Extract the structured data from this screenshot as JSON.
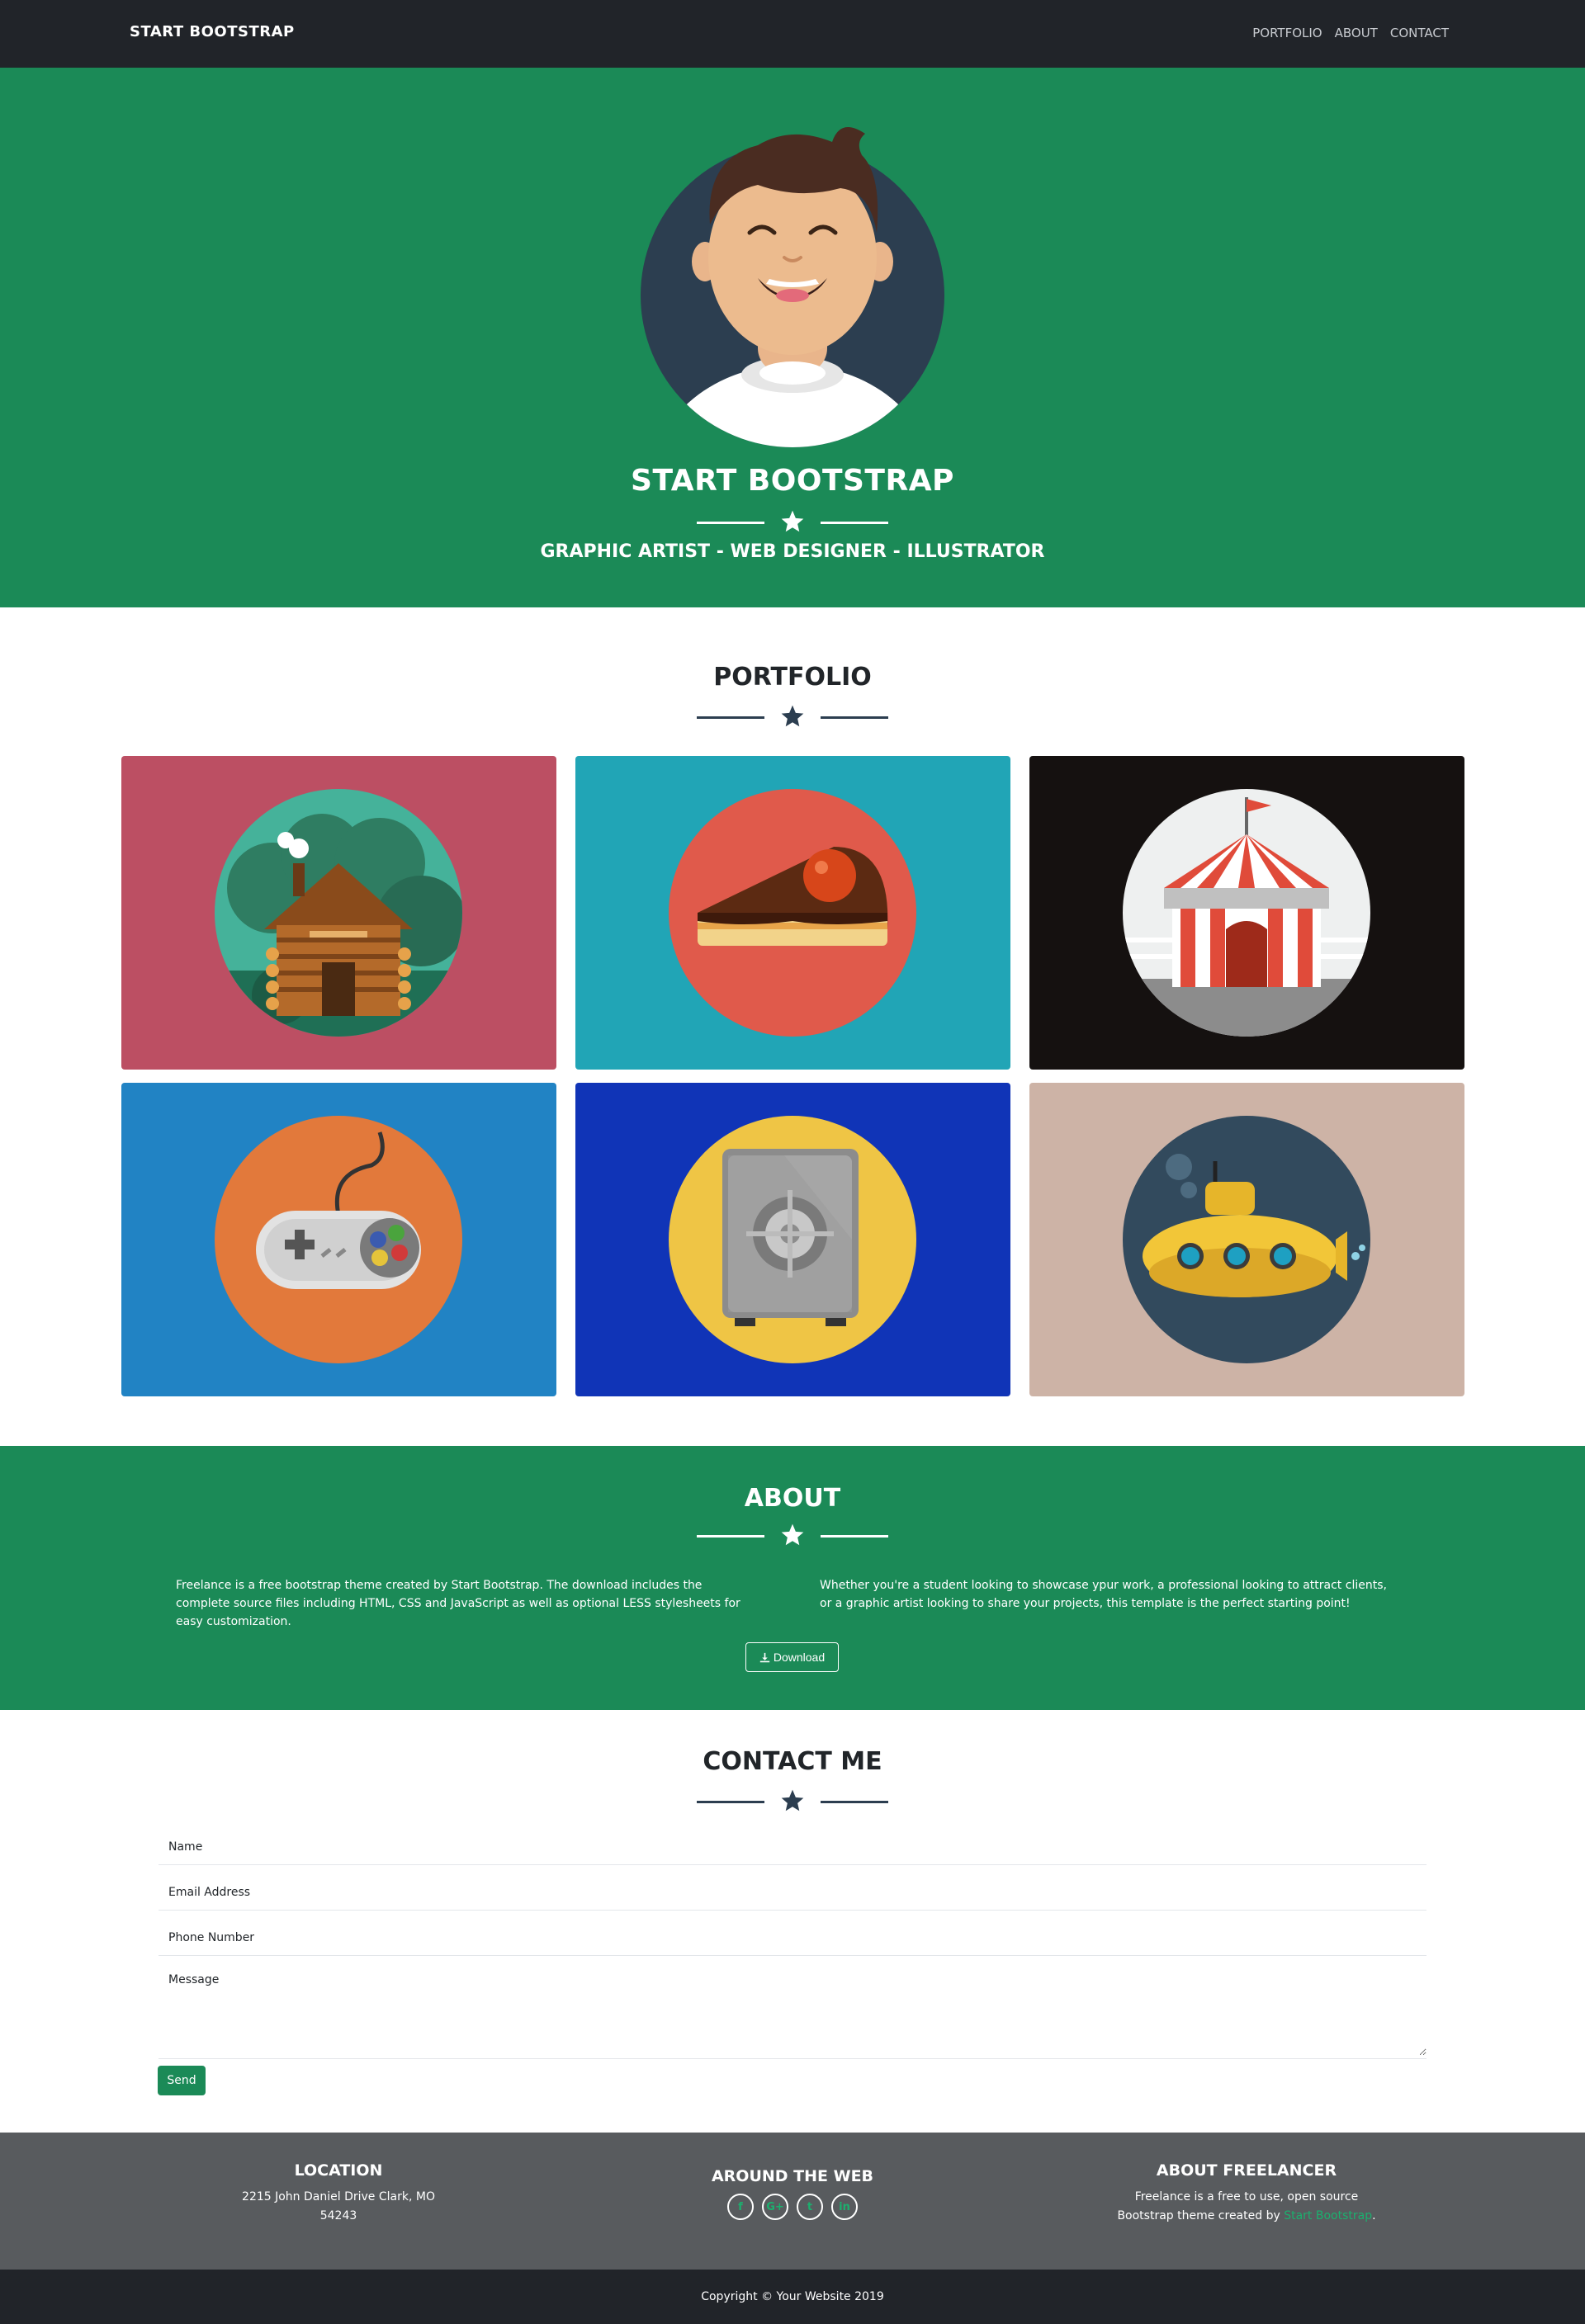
{
  "navbar": {
    "brand": "START BOOTSTRAP",
    "links": [
      "PORTFOLIO",
      "ABOUT",
      "CONTACT"
    ]
  },
  "hero": {
    "title": "START BOOTSTRAP",
    "subtitle": "GRAPHIC ARTIST - WEB DESIGNER - ILLUSTRATOR"
  },
  "portfolio": {
    "heading": "PORTFOLIO",
    "items": [
      {
        "icon": "cabin-icon",
        "bg": "#bc4f63"
      },
      {
        "icon": "cake-icon",
        "bg": "#21a5b6"
      },
      {
        "icon": "circus-tent-icon",
        "bg": "#151110"
      },
      {
        "icon": "game-controller-icon",
        "bg": "#2183c4"
      },
      {
        "icon": "safe-icon",
        "bg": "#1034b7"
      },
      {
        "icon": "submarine-icon",
        "bg": "#cdb3a6"
      }
    ]
  },
  "about": {
    "heading": "ABOUT",
    "left_text": "Freelance is a free bootstrap theme created by Start Bootstrap. The download includes the complete source files including HTML, CSS and JavaScript as well as optional LESS stylesheets for easy customization.",
    "right_text": "Whether you're a student looking to showcase ypur work, a professional looking to attract clients, or a graphic artist looking to share your projects, this template is the perfect starting point!",
    "download_label": "Download"
  },
  "contact": {
    "heading": "CONTACT ME",
    "name_placeholder": "Name",
    "email_placeholder": "Email Address",
    "phone_placeholder": "Phone Number",
    "message_placeholder": "Message",
    "send_label": "Send"
  },
  "footer": {
    "location_heading": "LOCATION",
    "address_line1": "2215 John Daniel Drive Clark, MO",
    "address_line2": "54243",
    "web_heading": "AROUND THE WEB",
    "socials": [
      "f",
      "G+",
      "t",
      "in"
    ],
    "about_heading": "ABOUT FREELANCER",
    "about_line1": "Freelance is a free to use, open source",
    "about_line2_prefix": "Bootstrap theme created by",
    "about_link": "Start Bootstrap",
    "about_line2_suffix": ".",
    "copyright": "Copyright © Your Website 2019"
  },
  "colors": {
    "primary_green": "#1b8a57",
    "navbar_dark": "#212429",
    "footer_gray": "#585b5e",
    "heading_dark": "#2c3e50"
  }
}
